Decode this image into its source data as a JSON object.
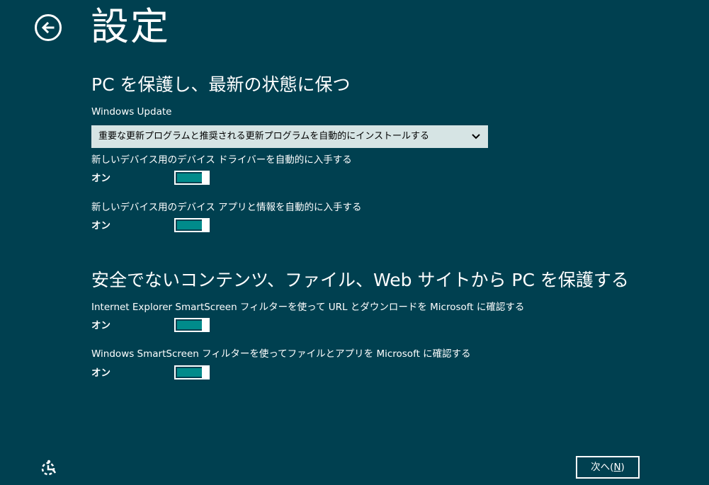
{
  "header": {
    "title": "設定",
    "back_icon": "back-arrow-icon"
  },
  "section1": {
    "heading": "PC を保護し、最新の状態に保つ",
    "windows_update_label": "Windows Update",
    "windows_update_selected": "重要な更新プログラムと推奨される更新プログラムを自動的にインストールする",
    "driver_label": "新しいデバイス用のデバイス ドライバーを自動的に入手する",
    "driver_state": "オン",
    "driver_on": true,
    "apps_label": "新しいデバイス用のデバイス アプリと情報を自動的に入手する",
    "apps_state": "オン",
    "apps_on": true
  },
  "section2": {
    "heading": "安全でないコンテンツ、ファイル、Web サイトから PC を保護する",
    "ie_smartscreen_label": "Internet Explorer SmartScreen フィルターを使って URL とダウンロードを Microsoft に確認する",
    "ie_smartscreen_state": "オン",
    "ie_smartscreen_on": true,
    "win_smartscreen_label": "Windows SmartScreen フィルターを使ってファイルとアプリを Microsoft に確認する",
    "win_smartscreen_state": "オン",
    "win_smartscreen_on": true
  },
  "footer": {
    "ease_of_access_icon": "ease-of-access-icon",
    "next_label": "次へ(",
    "next_accel": "N",
    "next_close": ")"
  },
  "colors": {
    "background": "#004050",
    "toggle_fill": "#008b8b",
    "dropdown_bg": "#d6e4e4"
  }
}
